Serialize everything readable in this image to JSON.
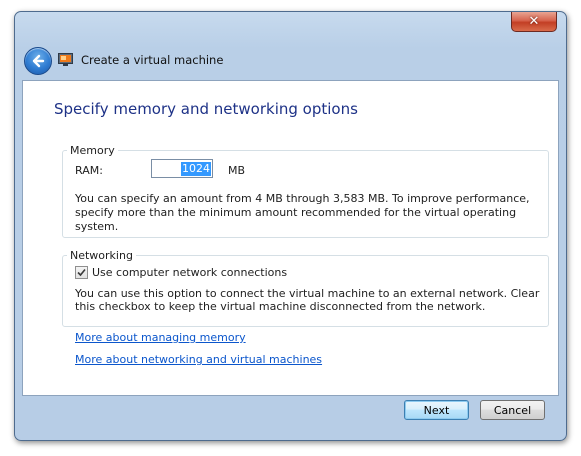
{
  "window": {
    "title": "Create a virtual machine",
    "close_glyph": "✕"
  },
  "icons": {
    "back": "back-arrow-icon",
    "app": "virtual-machine-icon",
    "close": "close-icon",
    "check": "checkmark-icon"
  },
  "page": {
    "heading": "Specify memory and networking options"
  },
  "memory": {
    "legend": "Memory",
    "ram_label": "RAM:",
    "ram_value": "1024",
    "ram_unit": "MB",
    "description": "You can specify an amount from 4 MB through 3,583 MB. To improve performance, specify more than the minimum amount recommended for the virtual operating system."
  },
  "networking": {
    "legend": "Networking",
    "checkbox_label": "Use computer network connections",
    "checked": true,
    "description": "You can use this option to connect the virtual machine to an external network. Clear this checkbox to keep the virtual machine disconnected from the network."
  },
  "links": {
    "memory": "More about managing memory",
    "networking": "More about networking and virtual machines"
  },
  "buttons": {
    "next": "Next",
    "cancel": "Cancel"
  },
  "colors": {
    "heading": "#1e3287",
    "link": "#0b56cc",
    "selection": "#3399ff",
    "close_button": "#c23e24"
  }
}
